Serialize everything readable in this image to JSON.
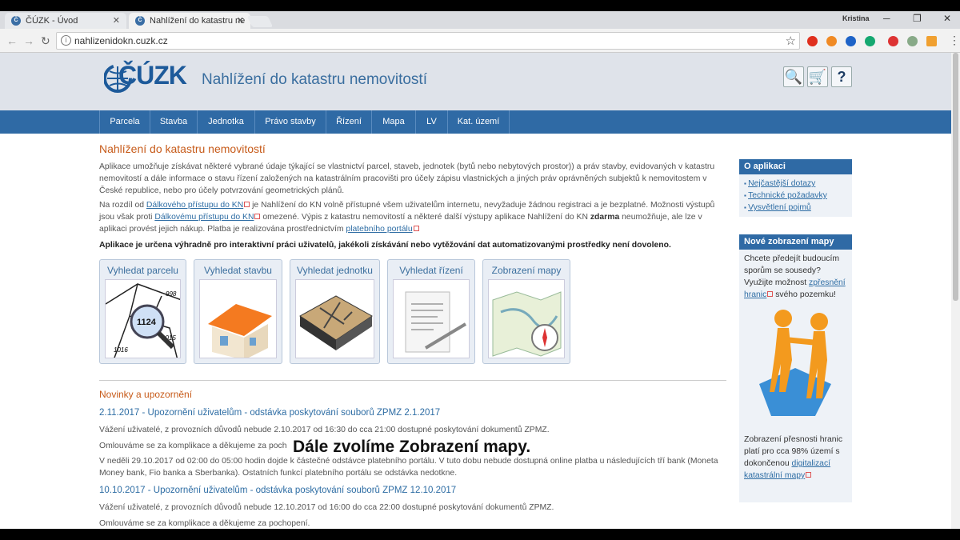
{
  "browser": {
    "tabs": [
      {
        "title": "ČÚZK - Úvod"
      },
      {
        "title": "Nahlížení do katastru ne"
      }
    ],
    "user": "Kristina",
    "url": "nahlizenidokn.cuzk.cz"
  },
  "header": {
    "logo_text": "ČÚZK",
    "site_title": "Nahlížení do katastru nemovitostí"
  },
  "nav": [
    "Parcela",
    "Stavba",
    "Jednotka",
    "Právo stavby",
    "Řízení",
    "Mapa",
    "LV",
    "Kat. území"
  ],
  "main": {
    "title": "Nahlížení do katastru nemovitostí",
    "p1": "Aplikace umožňuje získávat některé vybrané údaje týkající se vlastnictví parcel, staveb, jednotek (bytů nebo nebytových prostor)) a práv stavby, evidovaných v katastru nemovitostí a dále informace o stavu řízení založených na katastrálním pracovišti pro účely zápisu vlastnických a jiných práv oprávněných subjektů k nemovitostem v České republice, nebo pro účely potvrzování geometrických plánů.",
    "p2_a": "Na rozdíl od ",
    "p2_link1": "Dálkového přístupu do KN",
    "p2_b": " je Nahlížení do KN volně přístupné všem uživatelům internetu, nevyžaduje žádnou registraci a je bezplatné. Možnosti výstupů jsou však proti ",
    "p2_link2": "Dálkovému přístupu do KN",
    "p2_c": " omezené. Výpis z katastru nemovitostí a některé další výstupy aplikace Nahlížení do KN ",
    "p2_bold": "zdarma",
    "p2_d": " neumožňuje, ale lze v aplikaci provést jejich nákup. Platba je realizována prostřednictvím ",
    "p2_link3": "platebního portálu",
    "p3": "Aplikace je určena výhradně pro interaktivní práci uživatelů, jakékoli získávání nebo vytěžování dat automatizovanými prostředky není dovoleno.",
    "tiles": [
      {
        "label": "Vyhledat parcelu"
      },
      {
        "label": "Vyhledat stavbu"
      },
      {
        "label": "Vyhledat jednotku"
      },
      {
        "label": "Vyhledat řízení"
      },
      {
        "label": "Zobrazení mapy"
      }
    ],
    "parcel_number": "1124",
    "parcel_nums": [
      "998",
      "1015",
      "1016"
    ],
    "news_title": "Novinky a upozornění",
    "news": [
      {
        "heading": "2.11.2017 - Upozornění uživatelům - odstávka poskytování souborů ZPMZ 2.1.2017",
        "p1": "Vážení uživatelé, z provozních důvodů nebude 2.10.2017 od 16:30 do cca 21:00 dostupné poskytování dokumentů ZPMZ.",
        "p2": "Omlouváme se za komplikace a děkujeme za poch",
        "p3": "V neděli 29.10.2017 od 02:00 do 05:00 hodin dojde k částečné odstávce platebního portálu. V tuto dobu nebude dostupná online platba u následujících tří bank (Moneta Money bank, Fio banka a Sberbanka). Ostatních funkcí platebního portálu se odstávka nedotkne."
      },
      {
        "heading": "10.10.2017 - Upozornění uživatelům - odstávka poskytování souborů ZPMZ 12.10.2017",
        "p1": "Vážení uživatelé, z provozních důvodů nebude 12.10.2017 od 16:00 do cca 22:00 dostupné poskytování dokumentů ZPMZ.",
        "p2": "Omlouváme se za komplikace a děkujeme za pochopení."
      }
    ],
    "overlay_caption": "Dále zvolíme Zobrazení mapy."
  },
  "sidebar": {
    "about_title": "O aplikaci",
    "about_items": [
      "Nejčastější dotazy",
      "Technické požadavky",
      "Vysvětlení pojmů"
    ],
    "map_title": "Nové zobrazení mapy",
    "map_text_a": "Chcete předejít budoucím sporům se sousedy? Využijte možnost ",
    "map_link": "zpřesnění hranic",
    "map_text_b": " svého pozemku!",
    "bottom_text": "Zobrazení přesnosti hranic platí pro cca 98% území s dokončenou ",
    "bottom_link": "digitalizací katastrální mapy"
  },
  "colors": {
    "accent": "#2f6aa5",
    "title": "#c75b1a",
    "link": "#2e6da4"
  }
}
